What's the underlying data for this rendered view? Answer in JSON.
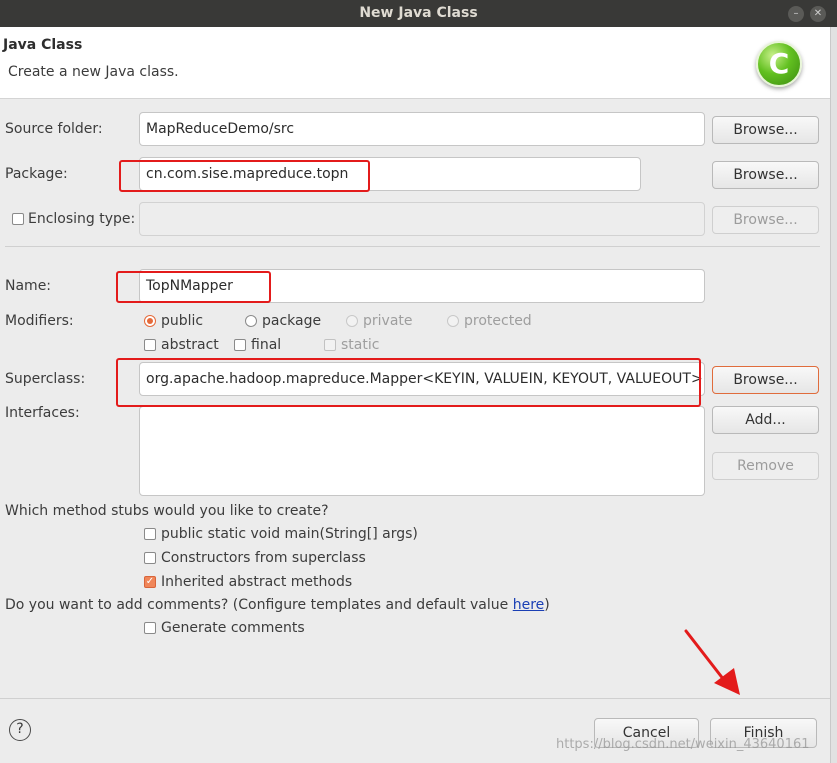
{
  "window": {
    "title": "New Java Class"
  },
  "header": {
    "title": "Java Class",
    "description": "Create a new Java class.",
    "icon": "java-class-c-icon"
  },
  "form": {
    "source_folder": {
      "label": "Source folder:",
      "value": "MapReduceDemo/src",
      "browse": "Browse..."
    },
    "package": {
      "label": "Package:",
      "value": "cn.com.sise.mapreduce.topn",
      "browse": "Browse..."
    },
    "enclosing_type": {
      "label": "Enclosing type:",
      "value": "",
      "browse": "Browse..."
    },
    "name": {
      "label": "Name:",
      "value": "TopNMapper"
    },
    "modifiers": {
      "label": "Modifiers:",
      "access": [
        "public",
        "package",
        "private",
        "protected"
      ],
      "selected_access": "public",
      "flags": [
        "abstract",
        "final",
        "static"
      ]
    },
    "superclass": {
      "label": "Superclass:",
      "value": "org.apache.hadoop.mapreduce.Mapper<KEYIN, VALUEIN, KEYOUT, VALUEOUT>",
      "browse": "Browse..."
    },
    "interfaces": {
      "label": "Interfaces:",
      "add": "Add...",
      "remove": "Remove"
    },
    "stubs": {
      "question": "Which method stubs would you like to create?",
      "options": [
        "public static void main(String[] args)",
        "Constructors from superclass",
        "Inherited abstract methods"
      ],
      "checked": [
        false,
        false,
        true
      ]
    },
    "comments": {
      "question": "Do you want to add comments? (Configure templates and default value ",
      "link": "here",
      "close_paren": ")",
      "option": "Generate comments"
    }
  },
  "footer": {
    "help": "?",
    "cancel": "Cancel",
    "finish": "Finish"
  },
  "watermark": "https://blog.csdn.net/weixin_43640161",
  "annotation_color": "#e31b1b"
}
